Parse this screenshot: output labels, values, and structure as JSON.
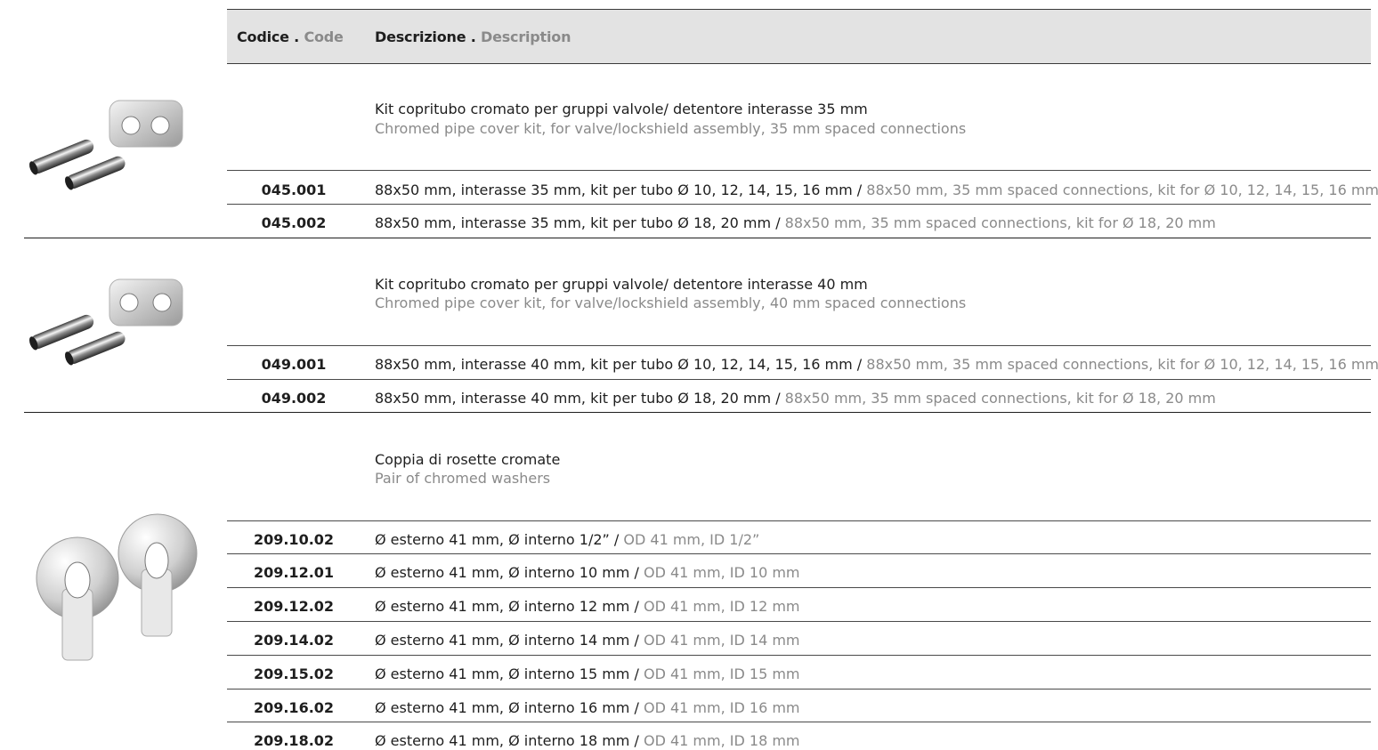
{
  "header": {
    "code_label": "Codice .",
    "code_label_en": "Code",
    "desc_label": "Descrizione .",
    "desc_label_en": "Description"
  },
  "groups": [
    {
      "title_it": "Kit copritubo cromato per gruppi valvole/ detentore interasse 35 mm",
      "title_en": "Chromed pipe cover kit, for valve/lockshield assembly, 35 mm spaced connections",
      "image_icon": "pipe-cover-kit-icon",
      "rows": [
        {
          "code": "045.001",
          "it": "88x50 mm, interasse 35 mm, kit per tubo Ø 10, 12, 14, 15, 16 mm /",
          "en": "88x50 mm, 35 mm spaced connections, kit for Ø 10, 12, 14, 15, 16 mm"
        },
        {
          "code": "045.002",
          "it": "88x50 mm, interasse 35 mm, kit per tubo Ø 18, 20 mm /",
          "en": "88x50 mm, 35 mm spaced connections, kit for Ø 18, 20 mm"
        }
      ]
    },
    {
      "title_it": "Kit copritubo cromato per gruppi valvole/ detentore interasse 40 mm",
      "title_en": "Chromed pipe cover kit, for valve/lockshield assembly, 40 mm spaced connections",
      "image_icon": "pipe-cover-kit-icon",
      "rows": [
        {
          "code": "049.001",
          "it": "88x50 mm, interasse 40 mm, kit per tubo Ø 10, 12, 14, 15, 16 mm /",
          "en": "88x50 mm, 35 mm spaced connections, kit for Ø 10, 12, 14, 15, 16 mm"
        },
        {
          "code": "049.002",
          "it": "88x50 mm, interasse 40 mm, kit per tubo Ø 18, 20 mm /",
          "en": "88x50 mm, 35 mm spaced connections, kit for Ø 18, 20 mm"
        }
      ]
    },
    {
      "title_it": "Coppia di rosette cromate",
      "title_en": "Pair of chromed washers",
      "image_icon": "chromed-washers-icon",
      "rows": [
        {
          "code": "209.10.02",
          "it": "Ø esterno 41 mm, Ø interno 1/2” /",
          "en": "OD 41 mm, ID 1/2”"
        },
        {
          "code": "209.12.01",
          "it": "Ø esterno 41 mm, Ø interno 10 mm /",
          "en": "OD 41 mm, ID 10 mm"
        },
        {
          "code": "209.12.02",
          "it": "Ø esterno 41 mm, Ø interno 12 mm /",
          "en": "OD 41 mm, ID 12 mm"
        },
        {
          "code": "209.14.02",
          "it": "Ø esterno 41 mm, Ø interno 14 mm /",
          "en": "OD 41 mm, ID 14 mm"
        },
        {
          "code": "209.15.02",
          "it": "Ø esterno 41 mm, Ø interno 15 mm /",
          "en": "OD 41 mm, ID 15 mm"
        },
        {
          "code": "209.16.02",
          "it": "Ø esterno 41 mm, Ø interno 16 mm /",
          "en": "OD 41 mm, ID 16 mm"
        },
        {
          "code": "209.18.02",
          "it": "Ø esterno 41 mm, Ø interno 18 mm /",
          "en": "OD 41 mm, ID 18 mm"
        }
      ]
    }
  ],
  "colors": {
    "text": "#1e1e1e",
    "secondary": "#8a8a8a",
    "header_bg": "#e3e3e3"
  }
}
